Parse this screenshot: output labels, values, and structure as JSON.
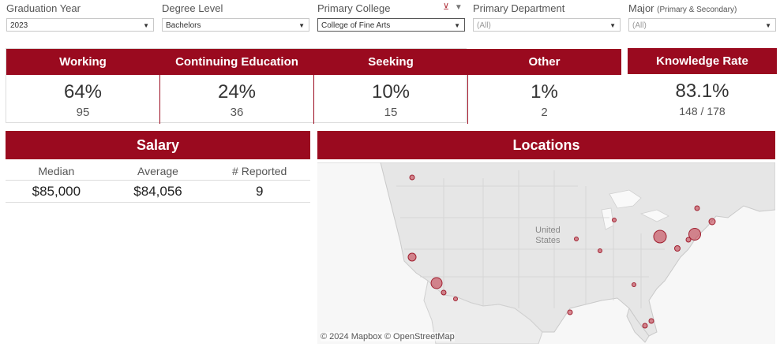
{
  "filters": [
    {
      "label": "Graduation Year",
      "value": "2023"
    },
    {
      "label": "Degree Level",
      "value": "Bachelors"
    },
    {
      "label": "Primary College",
      "value": "College of Fine Arts"
    },
    {
      "label": "Primary Department",
      "value": "(All)"
    },
    {
      "label": "Major",
      "label_small": "(Primary & Secondary)",
      "value": "(All)"
    }
  ],
  "kpis": [
    {
      "label": "Working",
      "pct": "64%",
      "count": "95"
    },
    {
      "label": "Continuing Education",
      "pct": "24%",
      "count": "36"
    },
    {
      "label": "Seeking",
      "pct": "10%",
      "count": "15"
    },
    {
      "label": "Other",
      "pct": "1%",
      "count": "2"
    }
  ],
  "knowledge": {
    "label": "Knowledge Rate",
    "pct": "83.1%",
    "count": "148 / 178"
  },
  "salary": {
    "title": "Salary",
    "headers": [
      "Median",
      "Average",
      "# Reported"
    ],
    "values": [
      "$85,000",
      "$84,056",
      "9"
    ]
  },
  "locations": {
    "title": "Locations",
    "country_line1": "United",
    "country_line2": "States",
    "credit": "© 2024 Mapbox  © OpenStreetMap",
    "marker_color": "#c0303f"
  },
  "colors": {
    "accent": "#9a0a1f"
  }
}
